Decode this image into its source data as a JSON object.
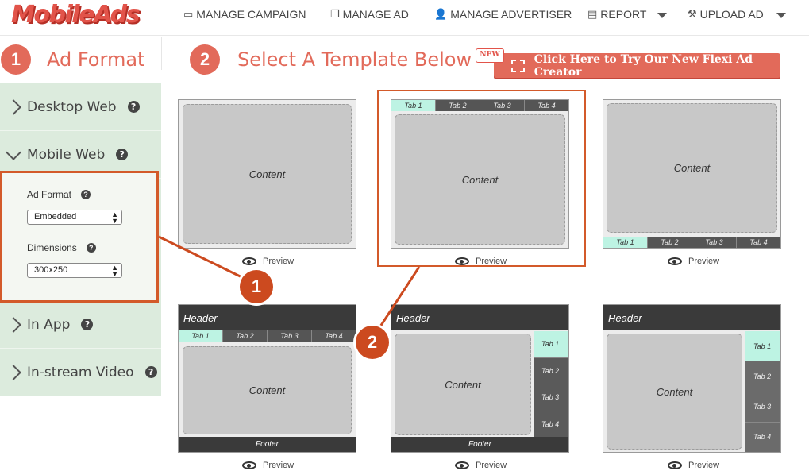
{
  "brand": {
    "logo": "MobileAds",
    "accent": "#e26a5a"
  },
  "nav": {
    "manage_campaign": "MANAGE CAMPAIGN",
    "manage_ad": "MANAGE AD",
    "manage_advertiser": "MANAGE ADVERTISER",
    "report": "REPORT",
    "upload_ad": "UPLOAD AD"
  },
  "steps": {
    "one": {
      "number": "1",
      "title": "Ad Format"
    },
    "two": {
      "number": "2",
      "title": "Select A Template Below"
    }
  },
  "flexi": {
    "badge": "NEW",
    "label": "Click Here to Try Our New Flexi Ad Creator"
  },
  "sidebar": {
    "desktop_web": "Desktop Web",
    "mobile_web": "Mobile Web",
    "in_app": "In App",
    "in_stream_video": "In-stream Video",
    "help": "?",
    "ad_format_label": "Ad Format",
    "ad_format_value": "Embedded",
    "dimensions_label": "Dimensions",
    "dimensions_value": "300x250"
  },
  "templates": {
    "content": "Content",
    "header": "Header",
    "footer": "Footer",
    "preview": "Preview",
    "tab1": "Tab 1",
    "tab2": "Tab 2",
    "tab3": "Tab 3",
    "tab4": "Tab 4"
  },
  "callouts": {
    "one": "1",
    "two": "2"
  },
  "colors": {
    "sidebar_bg": "#dcebdd",
    "highlight": "#d35a2a",
    "active_tab": "#bdf3e3"
  }
}
